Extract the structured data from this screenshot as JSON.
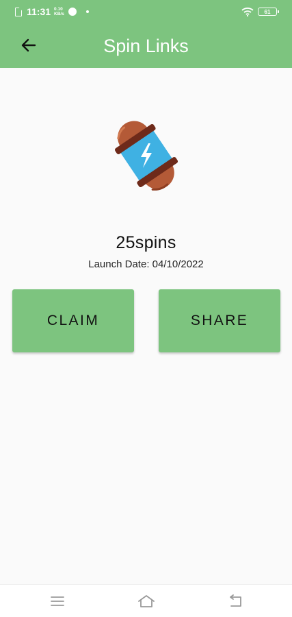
{
  "status_bar": {
    "time": "11:31",
    "speed_value": "0.10",
    "speed_unit": "KB/s",
    "battery": "61",
    "icons": [
      "sim-icon",
      "app-notification-icon",
      "dot-icon",
      "wifi-icon",
      "battery-icon"
    ]
  },
  "app_bar": {
    "title": "Spin Links",
    "back_icon": "arrow-left-icon"
  },
  "item": {
    "image": "spin-energy-capsule-icon",
    "title": "25spins",
    "launch_label": "Launch Date:",
    "launch_date": "04/10/2022"
  },
  "actions": {
    "claim_label": "CLAIM",
    "share_label": "SHARE"
  },
  "nav": {
    "icons": [
      "menu-icon",
      "home-icon",
      "back-icon"
    ]
  },
  "colors": {
    "accent": "#7dc47f",
    "background": "#fafafa",
    "capsule_cap": "#b45a37",
    "capsule_band": "#6e2a1a",
    "capsule_body": "#3fb1e3"
  }
}
